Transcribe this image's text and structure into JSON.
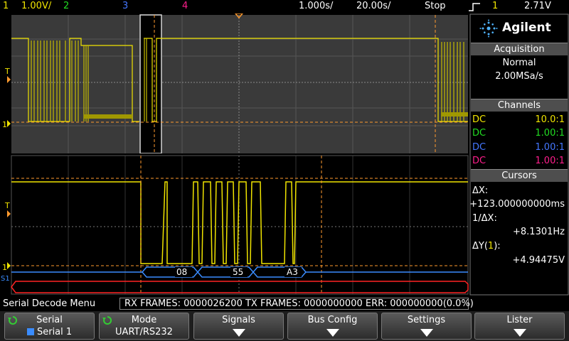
{
  "topbar": {
    "ch1_num": "1",
    "ch1_scale": "1.00V/",
    "ch2_num": "2",
    "ch3_num": "3",
    "ch4_num": "4",
    "horiz_scale": "1.000s/",
    "horiz_delay": "20.00s/",
    "run_state": "Stop",
    "trig_channel": "1",
    "trig_level": "2.71V"
  },
  "brand": {
    "logo": "Agilent"
  },
  "acquisition": {
    "header": "Acquisition",
    "mode": "Normal",
    "rate": "2.00MSa/s"
  },
  "channels": {
    "header": "Channels",
    "rows": [
      {
        "coupling": "DC",
        "probe": "10.0:1",
        "color": "#f0e400"
      },
      {
        "coupling": "DC",
        "probe": "1.00:1",
        "color": "#22dd22"
      },
      {
        "coupling": "DC",
        "probe": "1.00:1",
        "color": "#4477ff"
      },
      {
        "coupling": "DC",
        "probe": "1.00:1",
        "color": "#ff1e8c"
      }
    ]
  },
  "cursors": {
    "header": "Cursors",
    "dx_label": "ΔX:",
    "dx_value": "+123.000000000ms",
    "inv_label": "1/ΔX:",
    "inv_value": "+8.1301Hz",
    "dy_label_pre": "ΔY(",
    "dy_channel": "1",
    "dy_label_post": "):",
    "dy_value": "+4.94475V"
  },
  "waveform_labels": {
    "trig_marker": "T",
    "ch1_marker": "1",
    "serial_marker": "S1",
    "bytes": [
      "08",
      "55",
      "A3"
    ]
  },
  "decode": {
    "menu_title": "Serial Decode Menu",
    "status": "RX FRAMES: 0000026200  TX FRAMES: 0000000000  ERR: 000000000(0.0%)"
  },
  "softkeys": [
    {
      "label": "Serial",
      "value": "Serial 1"
    },
    {
      "label": "Mode",
      "value": "UART/RS232"
    },
    {
      "label": "Signals",
      "value": ""
    },
    {
      "label": "Bus Config",
      "value": ""
    },
    {
      "label": "Settings",
      "value": ""
    },
    {
      "label": "Lister",
      "value": ""
    }
  ],
  "colors": {
    "ch1": "#f0e400",
    "ch2": "#22dd22",
    "ch3": "#4477ff",
    "ch4": "#ff1e8c",
    "cursor": "#ff9a2e",
    "grid_bg": "#3a3a3a",
    "serial_bus": "#3a8cff",
    "serial_err": "#ff2222"
  }
}
